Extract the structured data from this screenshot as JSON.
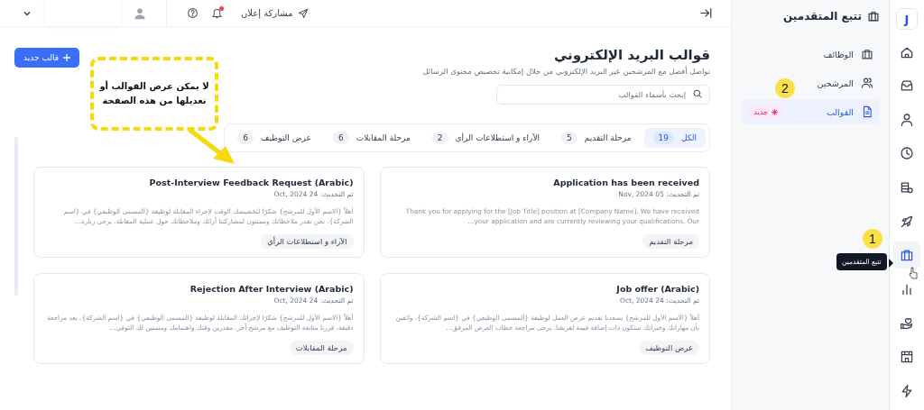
{
  "topbar": {
    "share_label": "مشاركة إعلان",
    "notification_unread": true
  },
  "rail": {
    "logo": "J",
    "items": [
      {
        "kind": "home",
        "selected": false
      },
      {
        "kind": "inbox",
        "selected": false
      },
      {
        "kind": "user",
        "selected": false
      },
      {
        "kind": "clock",
        "selected": false
      },
      {
        "kind": "coins",
        "selected": false
      },
      {
        "kind": "rocket",
        "selected": false
      },
      {
        "kind": "briefcase",
        "selected": true
      },
      {
        "kind": "chart",
        "selected": false
      },
      {
        "kind": "hand",
        "selected": false
      },
      {
        "kind": "store",
        "selected": false
      },
      {
        "kind": "bolt",
        "selected": false
      }
    ]
  },
  "tooltip": "تتبع المتقدمين",
  "sidebar": {
    "title": "تتبع المتقدمين",
    "items": [
      {
        "kind": "briefcase",
        "label": "الوظائف",
        "selected": false
      },
      {
        "kind": "users",
        "label": "المرشحين",
        "selected": false
      },
      {
        "kind": "file",
        "label": "القوالب",
        "selected": true,
        "badge": "جديد"
      }
    ]
  },
  "page": {
    "title": "قوالب البريد الإلكتروني",
    "subtitle": "تواصل أفضل مع المرشحين عبر البريد الإلكتروني من خلال إمكانية تخصيص محتوى الرسائل",
    "new_button": "قالب جديد",
    "search": {
      "placeholder": "إبحث بأسماء القوالب"
    }
  },
  "tabs": [
    {
      "label": "الكل",
      "count": "19",
      "selected": true
    },
    {
      "label": "مرحلة التقديم",
      "count": "5",
      "selected": false
    },
    {
      "label": "الآراء و استطلاعات الرأي",
      "count": "2",
      "selected": false
    },
    {
      "label": "مرحلة المقابلات",
      "count": "6",
      "selected": false
    },
    {
      "label": "عرض التوظيف",
      "count": "6",
      "selected": false
    }
  ],
  "cards": [
    {
      "title": "Application has been received",
      "updated": "تم التحديث: 05 Nov, 2024",
      "body": "Thank you for applying for the [Job Title] position at [Company Name]. We have received your application and are currently reviewing your qualifications. Our...",
      "tag": "مرحلة التقديم"
    },
    {
      "title": "Post-Interview Feedback Request (Arabic)",
      "updated": "تم التحديث: 24 Oct, 2024",
      "body": "أهلاً {الاسم الأول للمرشح} شكرًا لتخصيصك الوقت لإجراء المقابلة لوظيفة {المسمى الوظيفي} في {اسم الشركة}. نحن نقدر ملاحظاتك وممتنون لمشاركتنا آرائك وملاحظاتك حول عملية المقابلة. يرجى زيارة...",
      "tag": "الآراء و استطلاعات الرأي"
    },
    {
      "title": "Job offer (Arabic)",
      "updated": "تم التحديث: 24 Oct, 2024",
      "body": "أهلاً {الاسم الأول للمرشح} يسعدنا تقديم عرض العمل لوظيفة {المسمى الوظيفي} في {اسم الشركة}، واثقين بأن مهاراتك وخبراتك ستكون ذات إضافة قيمة لفريقنا. يرجى مراجعة خطاب العرض المرفق...",
      "tag": "عرض التوظيف"
    },
    {
      "title": "Rejection After Interview (Arabic)",
      "updated": "تم التحديث: 24 Oct, 2024",
      "body": "أهلاً {الاسم الأول للمرشح} شكرًا لإجرائك المقابلة لوظيفة {المسمى الوظيفي} في {اسم الشركة}. بعد مراجعة دقيقة، قررنا متابعة التوظيف مع مرشح آخر. مقدرين وقتك واهتمامك ومتمنين لك التوفي...",
      "tag": "مرحلة المقابلات"
    }
  ],
  "annotations": {
    "callout": "لا يمكن عرض القوالب أو تعديلها من هذه الصفحة",
    "markers": [
      {
        "label": "1"
      },
      {
        "label": "2"
      }
    ]
  }
}
